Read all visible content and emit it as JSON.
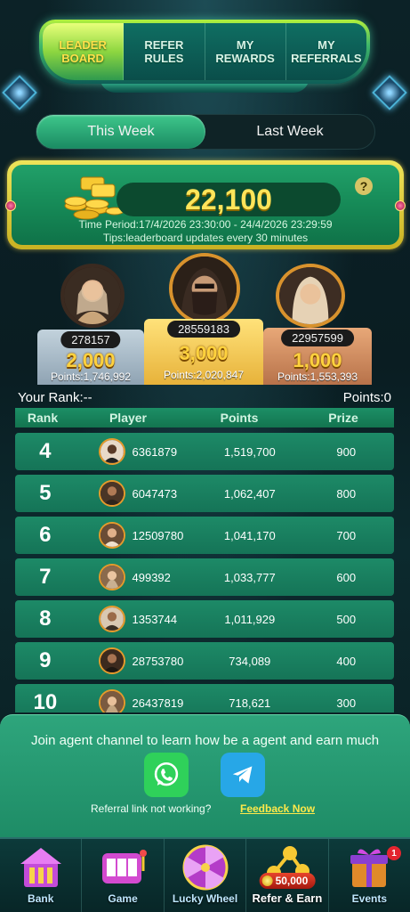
{
  "tabs": [
    {
      "label": "LEADER\nBOARD",
      "active": true
    },
    {
      "label": "REFER\nRULES",
      "active": false
    },
    {
      "label": "MY\nREWARDS",
      "active": false
    },
    {
      "label": "MY\nREFERRALS",
      "active": false
    }
  ],
  "week_toggle": {
    "this_week": "This Week",
    "last_week": "Last Week",
    "selected": "This Week"
  },
  "banner": {
    "amount": "22,100",
    "time_period": "Time Period:17/4/2026 23:30:00 - 24/4/2026 23:29:59",
    "tips": "Tips:leaderboard updates every 30 minutes",
    "help": "?"
  },
  "podium": {
    "first": {
      "id": "28559183",
      "prize": "3,000",
      "points": "Points:2,020,847"
    },
    "second": {
      "id": "278157",
      "prize": "2,000",
      "points": "Points:1,746,992"
    },
    "third": {
      "id": "22957599",
      "prize": "1,000",
      "points": "Points:1,553,393"
    }
  },
  "your_rank": {
    "rank_label": "Your Rank:--",
    "points_label": "Points:0"
  },
  "table": {
    "headers": {
      "rank": "Rank",
      "player": "Player",
      "points": "Points",
      "prize": "Prize"
    },
    "rows": [
      {
        "rank": "4",
        "player": "6361879",
        "points": "1,519,700",
        "prize": "900"
      },
      {
        "rank": "5",
        "player": "6047473",
        "points": "1,062,407",
        "prize": "800"
      },
      {
        "rank": "6",
        "player": "12509780",
        "points": "1,041,170",
        "prize": "700"
      },
      {
        "rank": "7",
        "player": "499392",
        "points": "1,033,777",
        "prize": "600"
      },
      {
        "rank": "8",
        "player": "1353744",
        "points": "1,011,929",
        "prize": "500"
      },
      {
        "rank": "9",
        "player": "28753780",
        "points": "734,089",
        "prize": "400"
      },
      {
        "rank": "10",
        "player": "26437819",
        "points": "718,621",
        "prize": "300"
      }
    ]
  },
  "agent_card": {
    "text": "Join agent channel to learn how be a agent and earn much",
    "referral_note": "Referral link not working?",
    "feedback": "Feedback Now",
    "apps": [
      "whatsapp-icon",
      "telegram-icon"
    ]
  },
  "bottom_nav": [
    {
      "label": "Bank",
      "icon": "bank-icon"
    },
    {
      "label": "Game",
      "icon": "slot-machine-icon"
    },
    {
      "label": "Lucky Wheel",
      "icon": "wheel-icon"
    },
    {
      "label": "Refer & Earn",
      "icon": "refer-icon",
      "pill": "50,000",
      "active": true
    },
    {
      "label": "Events",
      "icon": "gift-icon",
      "badge": "1"
    }
  ],
  "colors": {
    "accent_green": "#1d8a67",
    "gold": "#ffd23e",
    "link_yellow": "#ffe94a"
  }
}
